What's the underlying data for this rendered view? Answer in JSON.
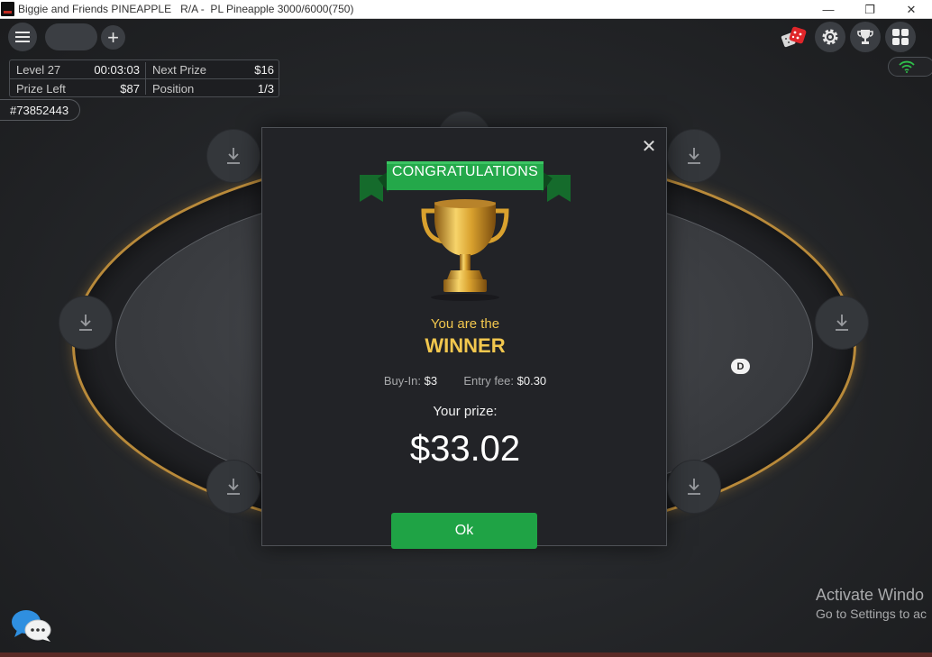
{
  "window": {
    "title": "Biggie and Friends PINEAPPLE   R/A -  PL Pineapple 3000/6000(750)",
    "minimize": "—",
    "maximize": "❐",
    "close": "✕"
  },
  "toolbar": {
    "add_label": "+",
    "right_icons": [
      "dice-icon",
      "gear-icon",
      "trophy-icon",
      "grid-icon",
      "wifi-icon"
    ]
  },
  "info": {
    "level_label": "Level 27",
    "level_time": "00:03:03",
    "next_prize_label": "Next Prize",
    "next_prize_value": "$16",
    "prize_left_label": "Prize Left",
    "prize_left_value": "$87",
    "position_label": "Position",
    "position_value": "1/3"
  },
  "table": {
    "id": "#73852443",
    "dealer_label": "D",
    "felt_color": "#3a3c40",
    "rail_color": "#b98a3a"
  },
  "modal": {
    "ribbon": "CONGRATULATIONS",
    "you_are": "You are the",
    "winner": "WINNER",
    "buyin_label": "Buy-In:",
    "buyin_value": "$3",
    "entry_fee_label": "Entry fee:",
    "entry_fee_value": "$0.30",
    "prize_label": "Your prize:",
    "prize_amount": "$33.02",
    "ok_label": "Ok",
    "accent_color": "#1fa345",
    "winner_color": "#f2c74e"
  },
  "watermark": {
    "line1": "Activate Windo",
    "line2": "Go to Settings to ac"
  }
}
